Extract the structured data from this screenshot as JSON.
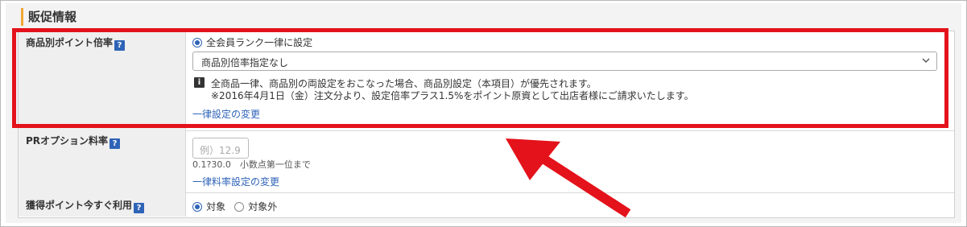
{
  "section": {
    "title": "販促情報"
  },
  "rows": {
    "point_rate": {
      "label": "商品別ポイント倍率",
      "radio_label": "全会員ランク一律に設定",
      "select_value": "商品別倍率指定なし",
      "note_line1": "全商品一律、商品別の両設定をおこなった場合、商品別設定（本項目）が優先されます。",
      "note_line2": "※2016年4月1日（金）注文分より、設定倍率プラス1.5%をポイント原資として出店者様にご請求いたします。",
      "link": "一律設定の変更"
    },
    "pr_option": {
      "label": "PRオプション料率",
      "placeholder": "例）12.9",
      "hint": "0.1?30.0　小数点第一位まで",
      "link": "一律料率設定の変更"
    },
    "instant_use": {
      "label": "獲得ポイント今すぐ利用",
      "option_on": "対象",
      "option_off": "対象外"
    }
  },
  "help_glyph": "?",
  "info_glyph": "i",
  "colors": {
    "highlight": "#e4121b",
    "accent": "#2e63b8",
    "title_bar": "#f0a733"
  }
}
